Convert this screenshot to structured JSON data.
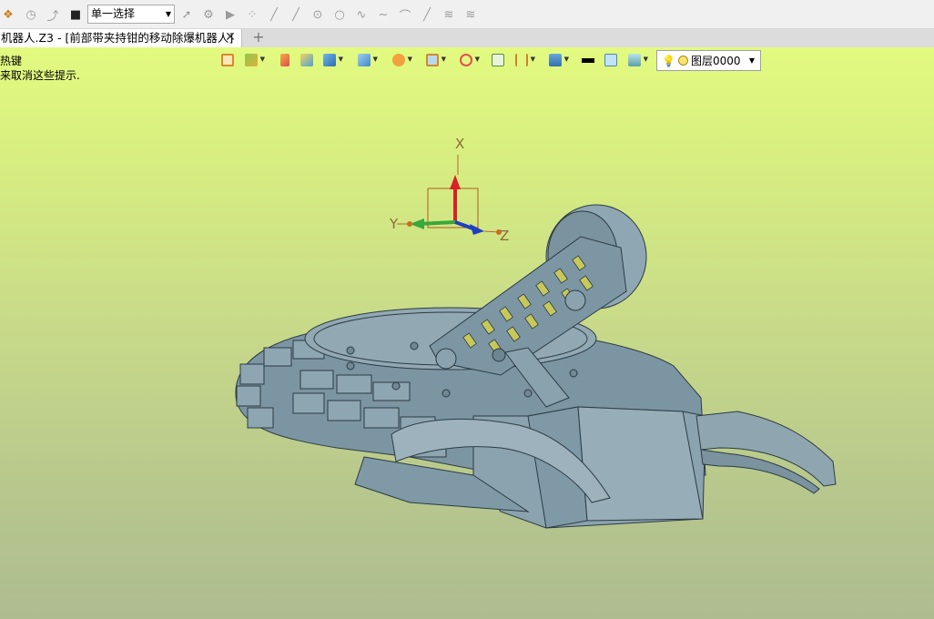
{
  "toolbar": {
    "selection_mode": "单一选择",
    "icons": [
      "app-icon",
      "history-icon",
      "redo-icon",
      "stop-icon",
      "cursor-icon",
      "filter-icon",
      "play-icon",
      "point-icon",
      "line-icon",
      "slash-icon",
      "circle-point-icon",
      "circle-icon",
      "wave-icon",
      "curve-icon",
      "arc-icon",
      "pen-icon",
      "layer-stack-icon",
      "stack-icon"
    ]
  },
  "tab": {
    "title": "机器人.Z3 - [前部带夹持钳的移动除爆机器人]",
    "close_glyph": "✕",
    "add_glyph": "+"
  },
  "hints": {
    "line1": "热键",
    "line2": "来取消这些提示."
  },
  "view_toolbar": {
    "layer_name": "图层0000"
  },
  "axes": {
    "x": "X",
    "y": "Y",
    "z": "Z"
  },
  "colors": {
    "model": "#7f99a6",
    "viewport_top": "#e3fa80",
    "viewport_bottom": "#aebc90"
  }
}
